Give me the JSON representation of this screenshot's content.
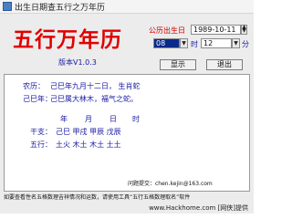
{
  "window": {
    "title": "出生日期查五行之万年历"
  },
  "header": {
    "main_title": "五行万年历",
    "version": "版本V1.0.3",
    "solar_calendar_label": "公历出生日"
  },
  "date_input": {
    "value": "1989-10-11"
  },
  "time_input": {
    "hour_value": "08",
    "minute_value": "12",
    "hour_unit": "时",
    "minute_unit": "分"
  },
  "buttons": {
    "show": "显示",
    "exit": "退出"
  },
  "result": {
    "lunar_label": "农历：",
    "lunar_value": "己巳年九月十二日， 生肖蛇",
    "year_label": "己巳年：",
    "year_value": "己巳属大林木，福气之蛇。",
    "pillar_headers": [
      "年",
      "月",
      "日",
      "时"
    ],
    "ganzhi_label": "干支：",
    "ganzhi_value": "己巳 甲戌 甲辰 戊辰",
    "wuxing_label": "五行：",
    "wuxing_value": "土火 木土 木土 土土"
  },
  "footer": {
    "contact": "问题提交：chen.kejin@163.com",
    "note": "如要查看性名五格数理吉祥情况和运数，请使用工具“五行五格数理取名”软件",
    "watermark": "www.Hackhome.com [网侠]提供"
  },
  "colors": {
    "title_red": "#e00000",
    "text_blue": "#1a1aa0",
    "label_red": "#d00000"
  }
}
